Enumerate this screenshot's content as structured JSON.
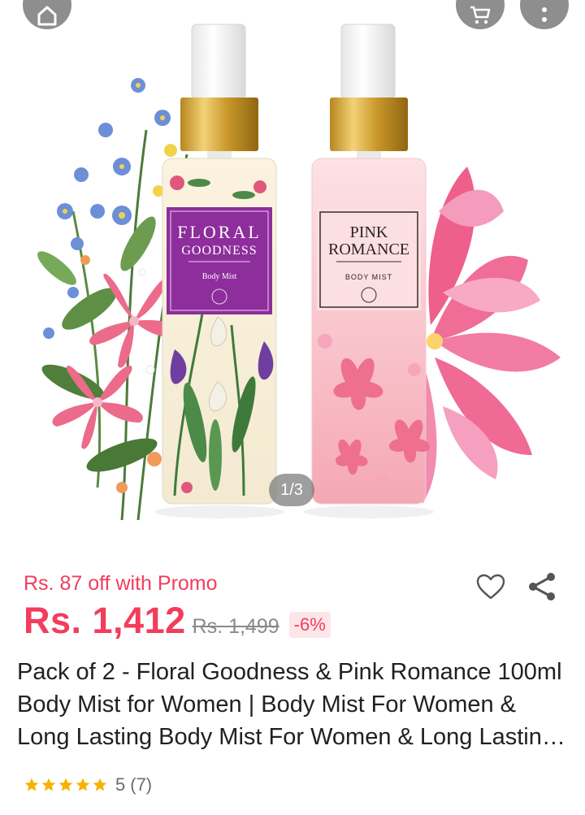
{
  "gallery": {
    "counter": "1/3",
    "bottle_left": {
      "brand": "FLORAL",
      "name": "GOODNESS",
      "type": "Body Mist"
    },
    "bottle_right": {
      "brand": "PINK",
      "name": "ROMANCE",
      "type": "BODY MIST"
    },
    "icons": {
      "home": "home-icon",
      "cart": "cart-icon",
      "more": "more-vertical-icon"
    }
  },
  "product": {
    "promo": "Rs. 87 off with Promo",
    "price": "Rs. 1,412",
    "original_price": "Rs. 1,499",
    "discount": "-6%",
    "title": "Pack of 2 - Floral Goodness & Pink Romance 100ml Body Mist for Women | Body Mist For Women & Long Lasting Body Mist For Women & Long Lasting Fragrance",
    "rating_value": 5,
    "rating_score": "5",
    "rating_count": "(7)"
  },
  "colors": {
    "accent": "#f23d5c",
    "star": "#f5b301",
    "muted": "#8a8a8a",
    "button_bg": "#8e8e8e"
  }
}
